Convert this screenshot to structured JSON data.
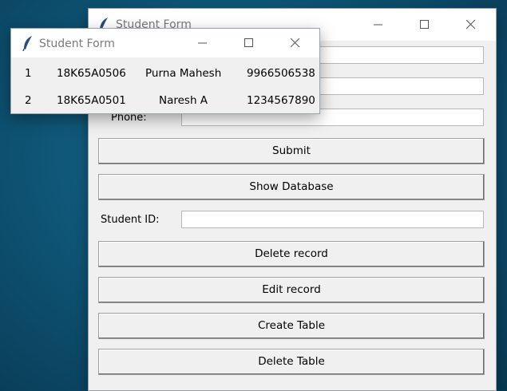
{
  "main_window": {
    "title": "Student Form",
    "phone_label": "Phone:",
    "submit_label": "Submit",
    "show_db_label": "Show Database",
    "student_id_label": "Student ID:",
    "delete_record_label": "Delete record",
    "edit_record_label": "Edit record",
    "create_table_label": "Create Table",
    "delete_table_label": "Delete Table"
  },
  "popup_window": {
    "title": "Student Form",
    "rows": [
      {
        "sno": "1",
        "id": "18K65A0506",
        "name": "Purna Mahesh",
        "phone": "9966506538"
      },
      {
        "sno": "2",
        "id": "18K65A0501",
        "name": "Naresh A",
        "phone": "1234567890"
      }
    ]
  },
  "icons": [
    "feather-icon",
    "minimize-icon",
    "maximize-icon",
    "close-icon"
  ],
  "colors": {
    "desktop": "#0f5677",
    "window": "#f0f0f0",
    "titlebar": "#ffffff"
  }
}
